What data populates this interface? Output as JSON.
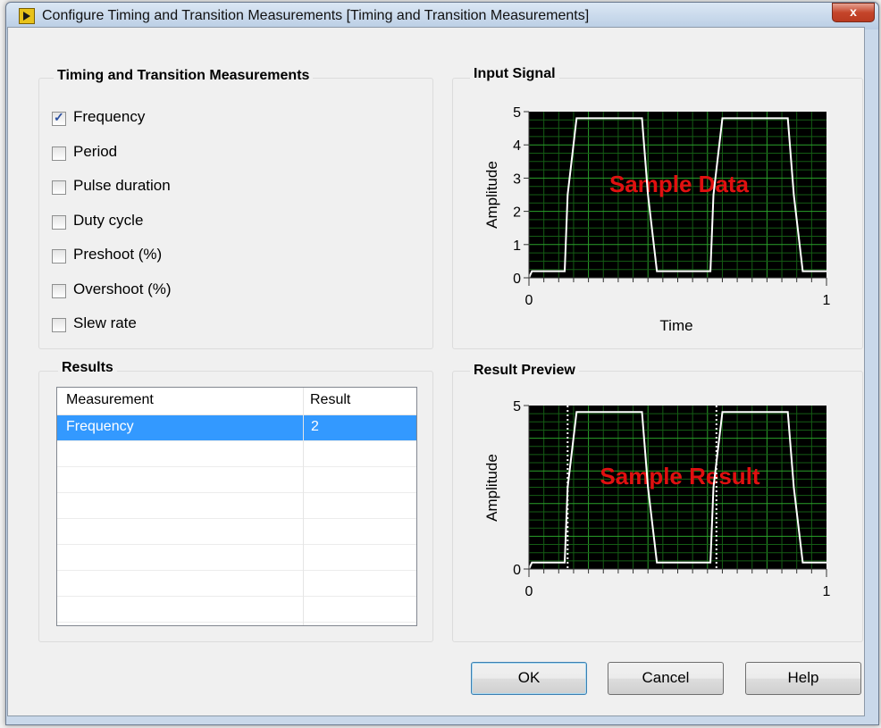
{
  "window": {
    "title": "Configure Timing and Transition Measurements [Timing and Transition Measurements]",
    "close_glyph": "x"
  },
  "measurements_group": {
    "label": "Timing and Transition Measurements",
    "items": [
      {
        "label": "Frequency",
        "checked": true
      },
      {
        "label": "Period",
        "checked": false
      },
      {
        "label": "Pulse duration",
        "checked": false
      },
      {
        "label": "Duty cycle",
        "checked": false
      },
      {
        "label": "Preshoot (%)",
        "checked": false
      },
      {
        "label": "Overshoot (%)",
        "checked": false
      },
      {
        "label": "Slew rate",
        "checked": false
      }
    ]
  },
  "results": {
    "label": "Results",
    "columns": [
      "Measurement",
      "Result"
    ],
    "rows": [
      {
        "measurement": "Frequency",
        "result": "2",
        "selected": true
      }
    ]
  },
  "input_signal": {
    "label": "Input Signal",
    "overlay": "Sample Data",
    "xlabel": "Time",
    "ylabel": "Amplitude",
    "y_ticks": [
      "0",
      "1",
      "2",
      "3",
      "4",
      "5"
    ],
    "x_ticks": [
      "0",
      "1"
    ]
  },
  "result_preview": {
    "label": "Result Preview",
    "overlay": "Sample Result",
    "ylabel": "Amplitude",
    "y_ticks": [
      "0",
      "5"
    ],
    "x_ticks": [
      "0",
      "1"
    ]
  },
  "buttons": {
    "ok": "OK",
    "cancel": "Cancel",
    "help": "Help"
  },
  "colors": {
    "plot_bg": "#000000",
    "grid": "#1e8a1e",
    "trace": "#ffffff",
    "overlay_text": "#e01010",
    "selection": "#3399ff"
  },
  "chart_data": [
    {
      "type": "line",
      "x": [
        0,
        0.01,
        0.12,
        0.13,
        0.16,
        0.38,
        0.4,
        0.43,
        0.61,
        0.62,
        0.65,
        0.87,
        0.89,
        0.92,
        1.0
      ],
      "y": [
        0,
        0.2,
        0.2,
        2.5,
        4.8,
        4.8,
        2.5,
        0.2,
        0.2,
        2.5,
        4.8,
        4.8,
        2.5,
        0.2,
        0.2
      ],
      "xlabel": "Time",
      "ylabel": "Amplitude",
      "xlim": [
        0,
        1
      ],
      "ylim": [
        0,
        5
      ],
      "grid": true
    },
    {
      "type": "line",
      "x": [
        0,
        0.01,
        0.12,
        0.13,
        0.16,
        0.38,
        0.4,
        0.43,
        0.61,
        0.62,
        0.65,
        0.87,
        0.89,
        0.92,
        1.0
      ],
      "y": [
        0,
        0.2,
        0.2,
        2.5,
        4.8,
        4.8,
        2.5,
        0.2,
        0.2,
        2.5,
        4.8,
        4.8,
        2.5,
        0.2,
        0.2
      ],
      "markers_x": [
        0.13,
        0.63
      ],
      "ylabel": "Amplitude",
      "xlim": [
        0,
        1
      ],
      "ylim": [
        0,
        5
      ],
      "grid": true
    }
  ]
}
